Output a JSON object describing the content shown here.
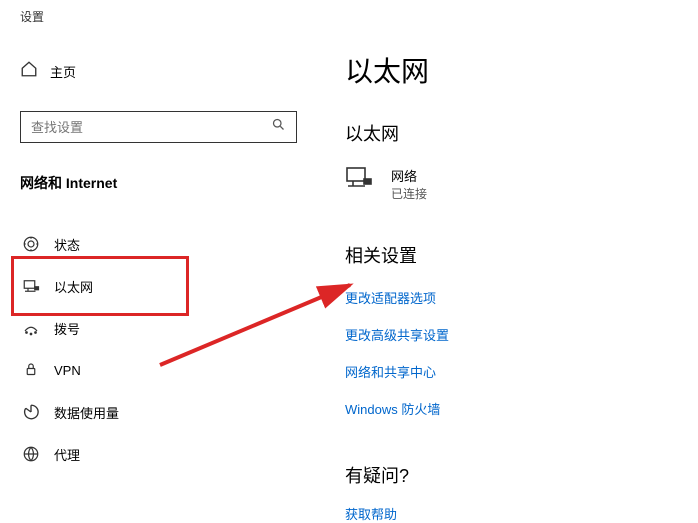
{
  "sidebar": {
    "app_title": "设置",
    "home_label": "主页",
    "search_placeholder": "查找设置",
    "category_title": "网络和 Internet",
    "items": [
      {
        "label": "状态"
      },
      {
        "label": "以太网"
      },
      {
        "label": "拨号"
      },
      {
        "label": "VPN"
      },
      {
        "label": "数据使用量"
      },
      {
        "label": "代理"
      }
    ]
  },
  "main": {
    "page_title": "以太网",
    "section_title": "以太网",
    "network": {
      "name": "网络",
      "status": "已连接"
    },
    "related_title": "相关设置",
    "links": [
      "更改适配器选项",
      "更改高级共享设置",
      "网络和共享中心",
      "Windows 防火墙"
    ],
    "help_title": "有疑问?",
    "help_link": "获取帮助"
  }
}
